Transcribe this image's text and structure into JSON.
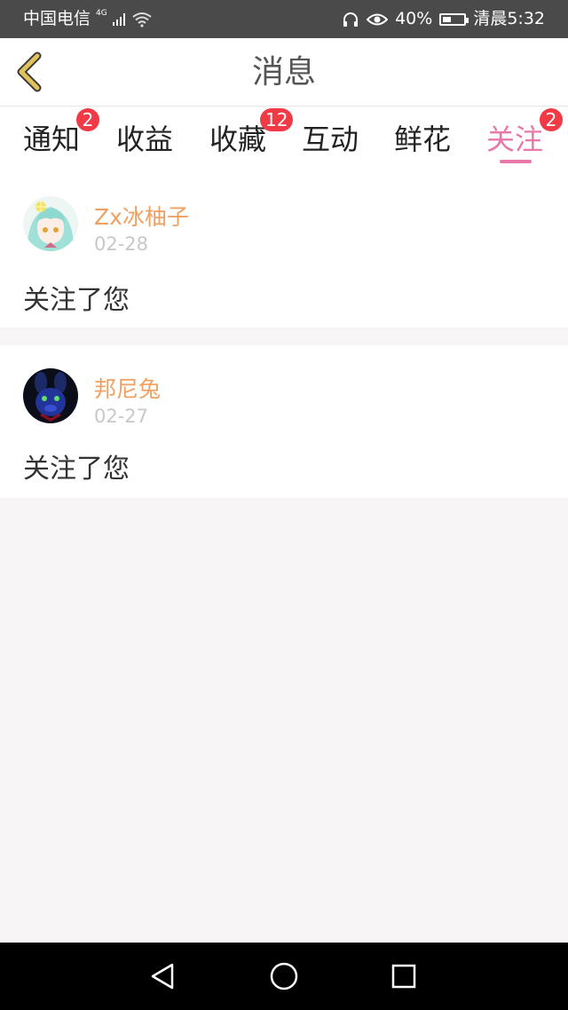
{
  "status_bar": {
    "carrier": "中国电信",
    "network": "4G",
    "battery_percent": "40%",
    "battery_level": 0.4,
    "time": "清晨5:32",
    "icons": [
      "signal-icon",
      "wifi-icon",
      "headphones-icon",
      "eye-icon",
      "battery-icon"
    ]
  },
  "header": {
    "title": "消息",
    "back_icon": "chevron-left-icon"
  },
  "tabs": [
    {
      "label": "通知",
      "badge": "2",
      "active": false
    },
    {
      "label": "收益",
      "badge": "",
      "active": false
    },
    {
      "label": "收藏",
      "badge": "12",
      "active": false
    },
    {
      "label": "互动",
      "badge": "",
      "active": false
    },
    {
      "label": "鲜花",
      "badge": "",
      "active": false
    },
    {
      "label": "关注",
      "badge": "2",
      "active": true
    }
  ],
  "items": [
    {
      "name": "Zx冰柚子",
      "date": "02-28",
      "text": "关注了您",
      "avatar": "anime-girl-avatar"
    },
    {
      "name": "邦尼兔",
      "date": "02-27",
      "text": "关注了您",
      "avatar": "dark-bunny-avatar"
    }
  ],
  "colors": {
    "accent": "#e878aa",
    "username": "#f0a060",
    "badge": "#f03a46",
    "back_chevron": "#e2c35b"
  },
  "nav_bar": {
    "icons": [
      "back-triangle-icon",
      "home-circle-icon",
      "recents-square-icon"
    ]
  }
}
